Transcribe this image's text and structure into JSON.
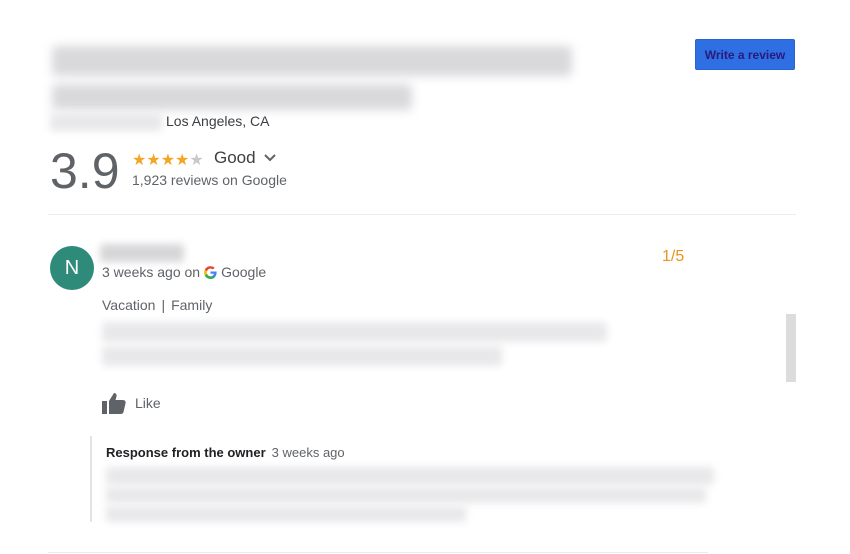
{
  "header": {
    "location": "Los Angeles, CA",
    "write_review_label": "Write a review"
  },
  "rating": {
    "score": "3.9",
    "stars_filled": 4,
    "stars_total": 5,
    "label": "Good",
    "reviews_text": "1,923 reviews on Google"
  },
  "review": {
    "avatar_initial": "N",
    "meta_text": "3 weeks ago on",
    "source": "Google",
    "page_indicator": "1/5",
    "tags": [
      "Vacation",
      "Family"
    ],
    "like_label": "Like",
    "owner_response": {
      "title": "Response from the owner",
      "time": "3 weeks ago"
    }
  },
  "colors": {
    "accent_button": "#2f6fe4",
    "star": "#f4a523",
    "avatar": "#2e8b7a",
    "page_indicator": "#e8951c"
  },
  "icons": {
    "expand": "chevron-down-icon",
    "source": "google-g-icon",
    "like": "thumbs-up-icon"
  }
}
